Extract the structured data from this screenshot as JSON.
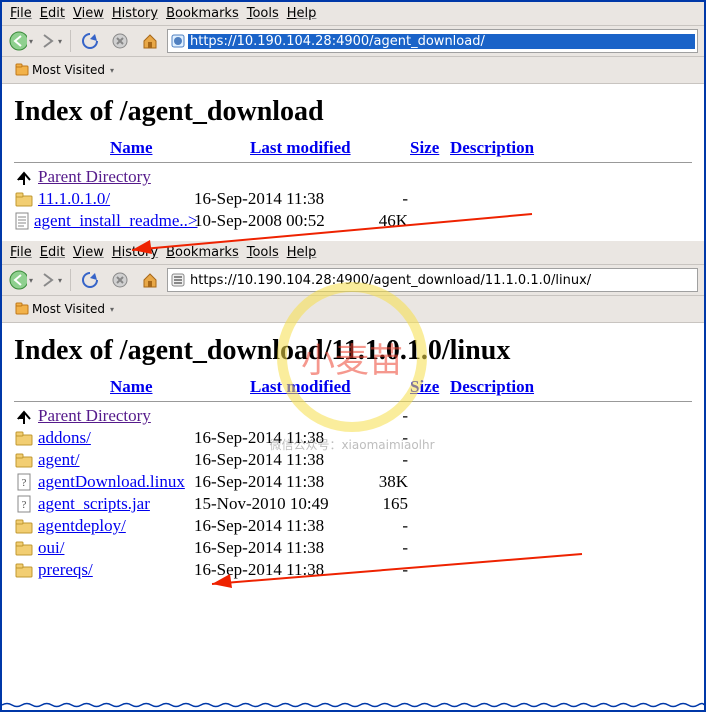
{
  "menubar": [
    "File",
    "Edit",
    "View",
    "History",
    "Bookmarks",
    "Tools",
    "Help"
  ],
  "bookmarks": {
    "most_visited": "Most Visited"
  },
  "upper": {
    "url": "https://10.190.104.28:4900/agent_download/",
    "heading": "Index of /agent_download",
    "headers": {
      "name": "Name",
      "modified": "Last modified",
      "size": "Size",
      "desc": "Description"
    },
    "rows": [
      {
        "icon": "up",
        "name": "Parent Directory",
        "mod": "",
        "size": "",
        "visited": true
      },
      {
        "icon": "folder",
        "name": "11.1.0.1.0/",
        "mod": "16-Sep-2014 11:38",
        "size": "-"
      },
      {
        "icon": "text",
        "name": "agent_install_readme..>",
        "mod": "10-Sep-2008 00:52",
        "size": "46K"
      }
    ]
  },
  "lower": {
    "url": "https://10.190.104.28:4900/agent_download/11.1.0.1.0/linux/",
    "heading": "Index of /agent_download/11.1.0.1.0/linux",
    "headers": {
      "name": "Name",
      "modified": "Last modified",
      "size": "Size",
      "desc": "Description"
    },
    "rows": [
      {
        "icon": "up",
        "name": "Parent Directory",
        "mod": "",
        "size": "-",
        "visited": true
      },
      {
        "icon": "folder",
        "name": "addons/",
        "mod": "16-Sep-2014 11:38",
        "size": "-"
      },
      {
        "icon": "folder",
        "name": "agent/",
        "mod": "16-Sep-2014 11:38",
        "size": "-"
      },
      {
        "icon": "unknown",
        "name": "agentDownload.linux",
        "mod": "16-Sep-2014 11:38",
        "size": "38K"
      },
      {
        "icon": "unknown",
        "name": "agent_scripts.jar",
        "mod": "15-Nov-2010 10:49",
        "size": "165"
      },
      {
        "icon": "folder",
        "name": "agentdeploy/",
        "mod": "16-Sep-2014 11:38",
        "size": "-"
      },
      {
        "icon": "folder",
        "name": "oui/",
        "mod": "16-Sep-2014 11:38",
        "size": "-"
      },
      {
        "icon": "folder",
        "name": "prereqs/",
        "mod": "16-Sep-2014 11:38",
        "size": "-"
      }
    ]
  },
  "watermark": {
    "big": "小麦苗",
    "sub": "微信公众号：xiaomaimiaolhr"
  }
}
